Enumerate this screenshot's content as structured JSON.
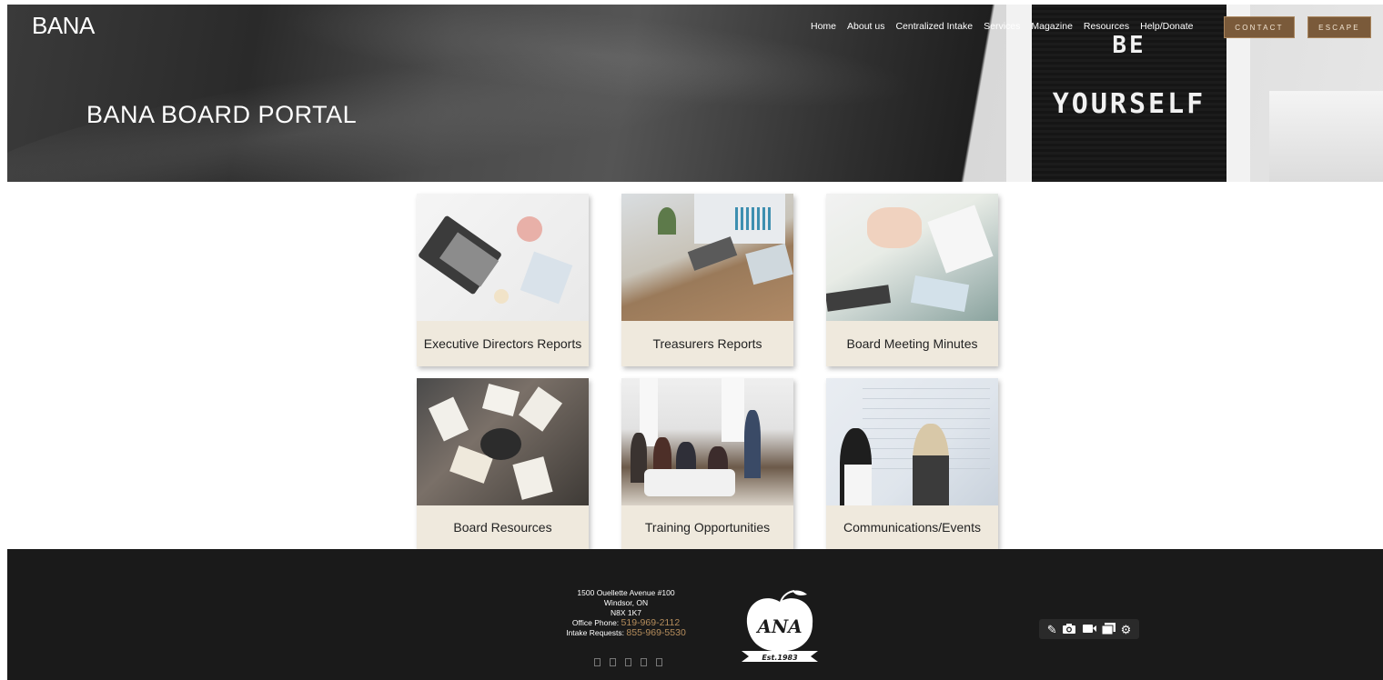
{
  "header": {
    "logo": "BANA",
    "nav": [
      "Home",
      "About us",
      "Centralized Intake",
      "Services",
      "Magazine",
      "Resources",
      "Help/Donate"
    ],
    "contact_label": "CONTACT",
    "escape_label": "ESCAPE",
    "accent_color": "#7a5a3a"
  },
  "hero": {
    "title": "BANA BOARD PORTAL",
    "letterboard_line1": "BE",
    "letterboard_line2": "YOURSELF"
  },
  "cards": [
    {
      "label": "Executive Directors Reports",
      "image": "laptop-desk-photo"
    },
    {
      "label": "Treasurers Reports",
      "image": "calculator-finance-photo"
    },
    {
      "label": "Board Meeting Minutes",
      "image": "meeting-calculator-photo"
    },
    {
      "label": "Board Resources",
      "image": "people-reading-books-photo"
    },
    {
      "label": "Training Opportunities",
      "image": "training-session-photo"
    },
    {
      "label": "Communications/Events",
      "image": "whiteboard-planning-photo"
    }
  ],
  "footer": {
    "address_line1": "1500 Ouellette Avenue #100",
    "address_line2": "Windsor, ON",
    "address_line3": "N8X 1K7",
    "office_label": "Office Phone:",
    "office_phone": "519-969-2112",
    "intake_label": "Intake Requests:",
    "intake_phone": "855-969-5530",
    "logo_text": "ANA",
    "logo_est": "Est.1983",
    "phone_color": "#b58d5c",
    "toolbar_icons": [
      "edit-icon",
      "camera-icon",
      "video-icon",
      "screens-icon",
      "gear-icon"
    ]
  }
}
